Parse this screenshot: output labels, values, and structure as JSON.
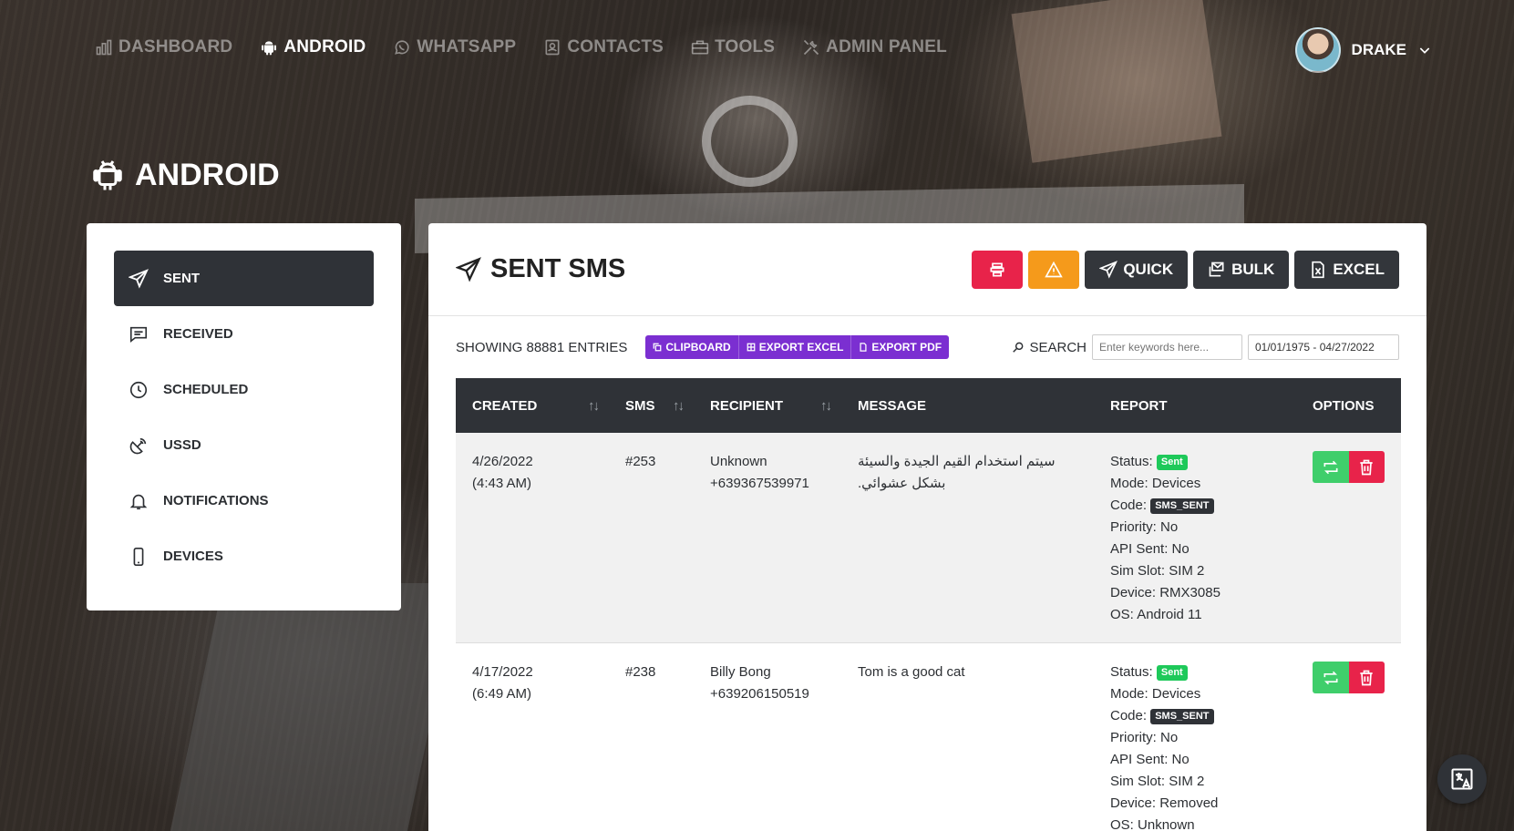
{
  "nav": {
    "items": [
      {
        "label": "DASHBOARD",
        "icon": "bar-chart-icon"
      },
      {
        "label": "ANDROID",
        "icon": "android-icon"
      },
      {
        "label": "WHATSAPP",
        "icon": "whatsapp-icon"
      },
      {
        "label": "CONTACTS",
        "icon": "contacts-icon"
      },
      {
        "label": "TOOLS",
        "icon": "briefcase-icon"
      },
      {
        "label": "ADMIN PANEL",
        "icon": "tools-icon"
      }
    ],
    "user": {
      "name": "DRAKE"
    }
  },
  "page": {
    "title": "ANDROID"
  },
  "sidebar": {
    "items": [
      {
        "label": "SENT",
        "icon": "send-icon"
      },
      {
        "label": "RECEIVED",
        "icon": "message-icon"
      },
      {
        "label": "SCHEDULED",
        "icon": "clock-icon"
      },
      {
        "label": "USSD",
        "icon": "satellite-icon"
      },
      {
        "label": "NOTIFICATIONS",
        "icon": "bell-icon"
      },
      {
        "label": "DEVICES",
        "icon": "phone-icon"
      }
    ]
  },
  "panel": {
    "title": "SENT SMS",
    "buttons": {
      "quick": "QUICK",
      "bulk": "BULK",
      "excel": "EXCEL"
    },
    "entries": "SHOWING 88881 ENTRIES",
    "exports": {
      "clipboard": "CLIPBOARD",
      "excel": "EXPORT EXCEL",
      "pdf": "EXPORT PDF"
    },
    "search_label": "SEARCH",
    "search_placeholder": "Enter keywords here...",
    "date_range": "01/01/1975 - 04/27/2022"
  },
  "table": {
    "headers": {
      "created": "CREATED",
      "sms": "SMS",
      "recipient": "RECIPIENT",
      "message": "MESSAGE",
      "report": "REPORT",
      "options": "OPTIONS"
    },
    "report_labels": {
      "status": "Status:",
      "mode": "Mode:",
      "code": "Code:",
      "priority": "Priority:",
      "api": "API Sent:",
      "sim": "Sim Slot:",
      "device": "Device:",
      "os": "OS:"
    },
    "rows": [
      {
        "date": "4/26/2022",
        "time": "(4:43 AM)",
        "sms": "#253",
        "recipient_name": "Unknown",
        "recipient_number": "+639367539971",
        "message": "سيتم استخدام القيم الجيدة والسيئة بشكل عشوائي.",
        "status": "Sent",
        "mode": "Devices",
        "code": "SMS_SENT",
        "priority": "No",
        "api": "No",
        "sim": "SIM 2",
        "device": "RMX3085",
        "os": "Android 11"
      },
      {
        "date": "4/17/2022",
        "time": "(6:49 AM)",
        "sms": "#238",
        "recipient_name": "Billy Bong",
        "recipient_number": "+639206150519",
        "message": "Tom is a good cat",
        "status": "Sent",
        "mode": "Devices",
        "code": "SMS_SENT",
        "priority": "No",
        "api": "No",
        "sim": "SIM 2",
        "device": "Removed",
        "os": "Unknown"
      }
    ]
  },
  "colors": {
    "accent_purple": "#7b2fd1",
    "danger": "#e8234a",
    "warning": "#f59a1b",
    "success": "#1ec95a",
    "dark": "#2f3237"
  }
}
